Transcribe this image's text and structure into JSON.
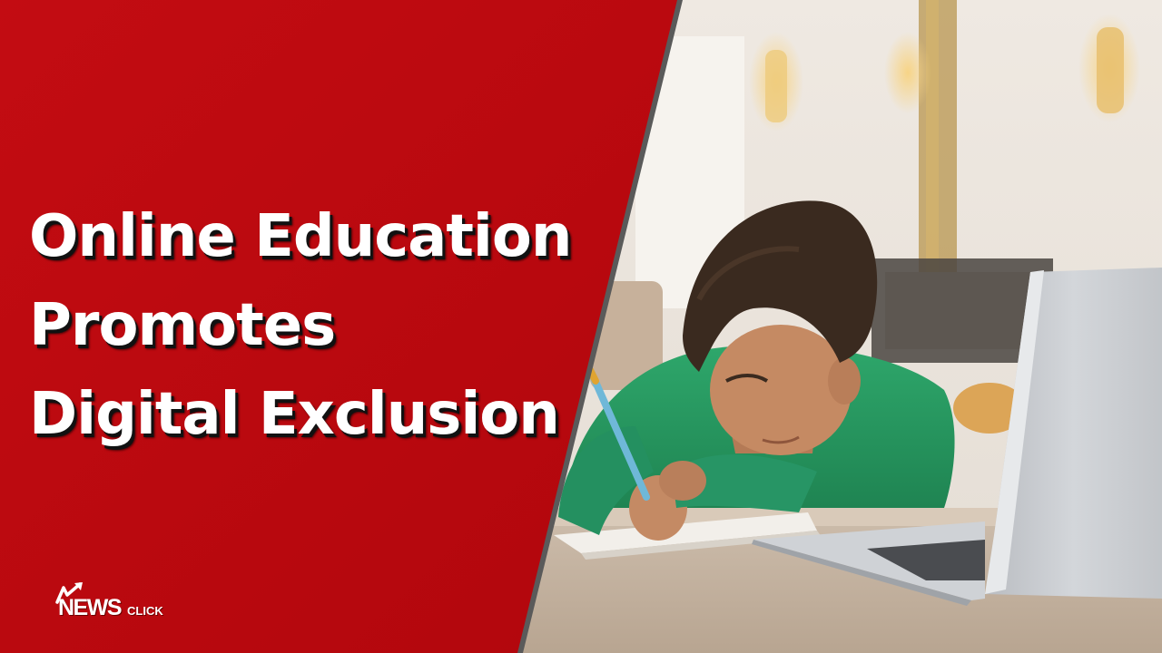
{
  "headline": {
    "line1": "Online Education",
    "line2": "Promotes",
    "line3": "Digital Exclusion"
  },
  "logo": {
    "news": "NEWS",
    "click": "CLICK",
    "icon": "newsclick-arrow-icon"
  },
  "colors": {
    "panel_red": "#c00a0f",
    "panel_red_dark": "#a60008",
    "headline_text": "#ffffff",
    "shirt_green": "#2a9a63"
  }
}
